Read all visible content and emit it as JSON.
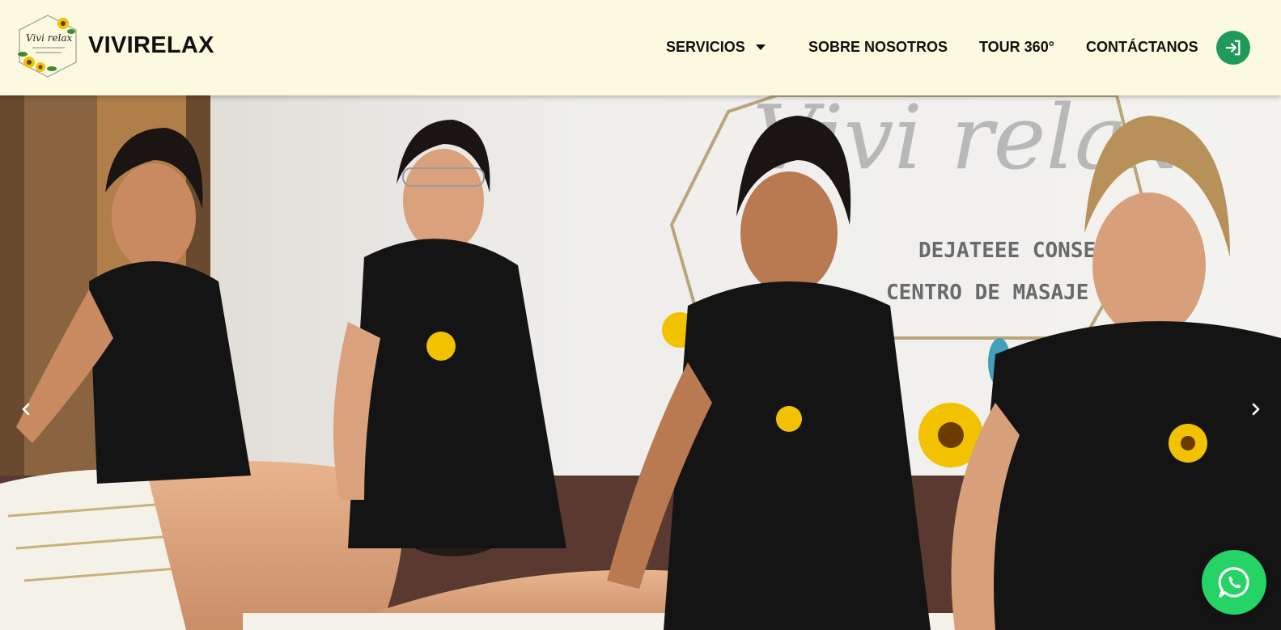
{
  "brand": {
    "name": "VIVIRELAX",
    "logo_text": "Vivi relax"
  },
  "nav": {
    "items": [
      {
        "label": "SERVICIOS",
        "has_dropdown": true
      },
      {
        "label": "SOBRE NOSOTROS"
      },
      {
        "label": "TOUR 360°"
      },
      {
        "label": "CONTÁCTANOS"
      }
    ],
    "login_icon": "login-icon"
  },
  "hero": {
    "wall_line_1": "DEJATEEE CONSENT",
    "wall_line_2": "CENTRO DE MASAJE",
    "wall_logo": "Vivi relax",
    "prev_icon": "chevron-left-icon",
    "next_icon": "chevron-right-icon"
  },
  "whatsapp": {
    "icon": "whatsapp-icon"
  },
  "colors": {
    "header_bg": "#fbf9e0",
    "accent_green": "#1f9a5b",
    "whatsapp_green": "#25d366",
    "text": "#111111"
  }
}
